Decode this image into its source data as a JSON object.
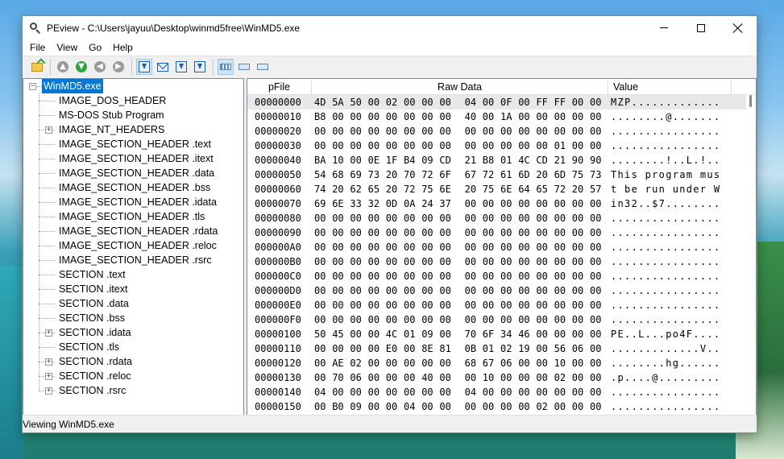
{
  "window": {
    "title": "PEview - C:\\Users\\jayuu\\Desktop\\winmd5free\\WinMD5.exe"
  },
  "menu": [
    "File",
    "View",
    "Go",
    "Help"
  ],
  "toolbar": {
    "icons": [
      "open-file-icon",
      "up-icon",
      "next-green-icon",
      "back-icon",
      "forward-icon",
      "go-to-icon",
      "envelope-icon",
      "jump-icon",
      "download-icon",
      "view-byte-icon",
      "view-word-icon",
      "view-dword-icon"
    ]
  },
  "tree": {
    "root": "WinMD5.exe",
    "items": [
      {
        "label": "IMAGE_DOS_HEADER",
        "expandable": false
      },
      {
        "label": "MS-DOS Stub Program",
        "expandable": false
      },
      {
        "label": "IMAGE_NT_HEADERS",
        "expandable": true
      },
      {
        "label": "IMAGE_SECTION_HEADER .text",
        "expandable": false
      },
      {
        "label": "IMAGE_SECTION_HEADER .itext",
        "expandable": false
      },
      {
        "label": "IMAGE_SECTION_HEADER .data",
        "expandable": false
      },
      {
        "label": "IMAGE_SECTION_HEADER .bss",
        "expandable": false
      },
      {
        "label": "IMAGE_SECTION_HEADER .idata",
        "expandable": false
      },
      {
        "label": "IMAGE_SECTION_HEADER .tls",
        "expandable": false
      },
      {
        "label": "IMAGE_SECTION_HEADER .rdata",
        "expandable": false
      },
      {
        "label": "IMAGE_SECTION_HEADER .reloc",
        "expandable": false
      },
      {
        "label": "IMAGE_SECTION_HEADER .rsrc",
        "expandable": false
      },
      {
        "label": "SECTION .text",
        "expandable": false
      },
      {
        "label": "SECTION .itext",
        "expandable": false
      },
      {
        "label": "SECTION .data",
        "expandable": false
      },
      {
        "label": "SECTION .bss",
        "expandable": false
      },
      {
        "label": "SECTION .idata",
        "expandable": true
      },
      {
        "label": "SECTION .tls",
        "expandable": false
      },
      {
        "label": "SECTION .rdata",
        "expandable": true
      },
      {
        "label": "SECTION .reloc",
        "expandable": true
      },
      {
        "label": "SECTION .rsrc",
        "expandable": true
      }
    ]
  },
  "hexview": {
    "columns": [
      "pFile",
      "Raw Data",
      "Value"
    ],
    "rows": [
      {
        "offset": "00000000",
        "bytes": [
          "4D",
          "5A",
          "50",
          "00",
          "02",
          "00",
          "00",
          "00",
          "04",
          "00",
          "0F",
          "00",
          "FF",
          "FF",
          "00",
          "00"
        ],
        "value": "MZP............."
      },
      {
        "offset": "00000010",
        "bytes": [
          "B8",
          "00",
          "00",
          "00",
          "00",
          "00",
          "00",
          "00",
          "40",
          "00",
          "1A",
          "00",
          "00",
          "00",
          "00",
          "00"
        ],
        "value": "........@......."
      },
      {
        "offset": "00000020",
        "bytes": [
          "00",
          "00",
          "00",
          "00",
          "00",
          "00",
          "00",
          "00",
          "00",
          "00",
          "00",
          "00",
          "00",
          "00",
          "00",
          "00"
        ],
        "value": "................"
      },
      {
        "offset": "00000030",
        "bytes": [
          "00",
          "00",
          "00",
          "00",
          "00",
          "00",
          "00",
          "00",
          "00",
          "00",
          "00",
          "00",
          "00",
          "01",
          "00",
          "00"
        ],
        "value": "................"
      },
      {
        "offset": "00000040",
        "bytes": [
          "BA",
          "10",
          "00",
          "0E",
          "1F",
          "B4",
          "09",
          "CD",
          "21",
          "B8",
          "01",
          "4C",
          "CD",
          "21",
          "90",
          "90"
        ],
        "value": "........!..L.!.."
      },
      {
        "offset": "00000050",
        "bytes": [
          "54",
          "68",
          "69",
          "73",
          "20",
          "70",
          "72",
          "6F",
          "67",
          "72",
          "61",
          "6D",
          "20",
          "6D",
          "75",
          "73"
        ],
        "value": "This program mus"
      },
      {
        "offset": "00000060",
        "bytes": [
          "74",
          "20",
          "62",
          "65",
          "20",
          "72",
          "75",
          "6E",
          "20",
          "75",
          "6E",
          "64",
          "65",
          "72",
          "20",
          "57"
        ],
        "value": "t be run under W"
      },
      {
        "offset": "00000070",
        "bytes": [
          "69",
          "6E",
          "33",
          "32",
          "0D",
          "0A",
          "24",
          "37",
          "00",
          "00",
          "00",
          "00",
          "00",
          "00",
          "00",
          "00"
        ],
        "value": "in32..$7........"
      },
      {
        "offset": "00000080",
        "bytes": [
          "00",
          "00",
          "00",
          "00",
          "00",
          "00",
          "00",
          "00",
          "00",
          "00",
          "00",
          "00",
          "00",
          "00",
          "00",
          "00"
        ],
        "value": "................"
      },
      {
        "offset": "00000090",
        "bytes": [
          "00",
          "00",
          "00",
          "00",
          "00",
          "00",
          "00",
          "00",
          "00",
          "00",
          "00",
          "00",
          "00",
          "00",
          "00",
          "00"
        ],
        "value": "................"
      },
      {
        "offset": "000000A0",
        "bytes": [
          "00",
          "00",
          "00",
          "00",
          "00",
          "00",
          "00",
          "00",
          "00",
          "00",
          "00",
          "00",
          "00",
          "00",
          "00",
          "00"
        ],
        "value": "................"
      },
      {
        "offset": "000000B0",
        "bytes": [
          "00",
          "00",
          "00",
          "00",
          "00",
          "00",
          "00",
          "00",
          "00",
          "00",
          "00",
          "00",
          "00",
          "00",
          "00",
          "00"
        ],
        "value": "................"
      },
      {
        "offset": "000000C0",
        "bytes": [
          "00",
          "00",
          "00",
          "00",
          "00",
          "00",
          "00",
          "00",
          "00",
          "00",
          "00",
          "00",
          "00",
          "00",
          "00",
          "00"
        ],
        "value": "................"
      },
      {
        "offset": "000000D0",
        "bytes": [
          "00",
          "00",
          "00",
          "00",
          "00",
          "00",
          "00",
          "00",
          "00",
          "00",
          "00",
          "00",
          "00",
          "00",
          "00",
          "00"
        ],
        "value": "................"
      },
      {
        "offset": "000000E0",
        "bytes": [
          "00",
          "00",
          "00",
          "00",
          "00",
          "00",
          "00",
          "00",
          "00",
          "00",
          "00",
          "00",
          "00",
          "00",
          "00",
          "00"
        ],
        "value": "................"
      },
      {
        "offset": "000000F0",
        "bytes": [
          "00",
          "00",
          "00",
          "00",
          "00",
          "00",
          "00",
          "00",
          "00",
          "00",
          "00",
          "00",
          "00",
          "00",
          "00",
          "00"
        ],
        "value": "................"
      },
      {
        "offset": "00000100",
        "bytes": [
          "50",
          "45",
          "00",
          "00",
          "4C",
          "01",
          "09",
          "00",
          "70",
          "6F",
          "34",
          "46",
          "00",
          "00",
          "00",
          "00"
        ],
        "value": "PE..L...po4F...."
      },
      {
        "offset": "00000110",
        "bytes": [
          "00",
          "00",
          "00",
          "00",
          "E0",
          "00",
          "8E",
          "81",
          "0B",
          "01",
          "02",
          "19",
          "00",
          "56",
          "06",
          "00"
        ],
        "value": ".............V.."
      },
      {
        "offset": "00000120",
        "bytes": [
          "00",
          "AE",
          "02",
          "00",
          "00",
          "00",
          "00",
          "00",
          "68",
          "67",
          "06",
          "00",
          "00",
          "10",
          "00",
          "00"
        ],
        "value": "........hg......"
      },
      {
        "offset": "00000130",
        "bytes": [
          "00",
          "70",
          "06",
          "00",
          "00",
          "00",
          "40",
          "00",
          "00",
          "10",
          "00",
          "00",
          "00",
          "02",
          "00",
          "00"
        ],
        "value": ".p....@........."
      },
      {
        "offset": "00000140",
        "bytes": [
          "04",
          "00",
          "00",
          "00",
          "00",
          "00",
          "00",
          "00",
          "04",
          "00",
          "00",
          "00",
          "00",
          "00",
          "00",
          "00"
        ],
        "value": "................"
      },
      {
        "offset": "00000150",
        "bytes": [
          "00",
          "B0",
          "09",
          "00",
          "00",
          "04",
          "00",
          "00",
          "00",
          "00",
          "00",
          "00",
          "02",
          "00",
          "00",
          "00"
        ],
        "value": "................"
      }
    ]
  },
  "status": {
    "text": "Viewing WinMD5.exe"
  }
}
